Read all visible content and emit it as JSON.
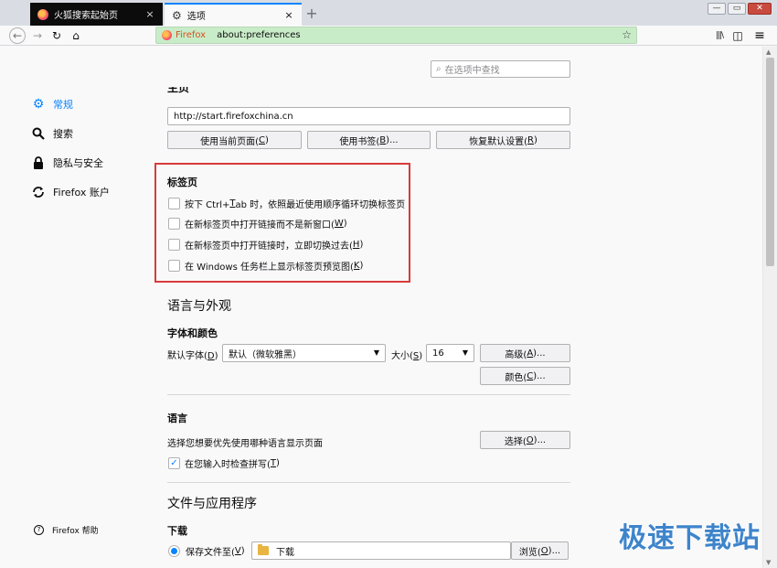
{
  "tabs": [
    {
      "title": "火狐搜索起始页",
      "close": "×"
    },
    {
      "title": "选项",
      "close": "×"
    }
  ],
  "newtab": "+",
  "window_controls": {
    "minimize": "—",
    "maximize": "▭",
    "close": "✕"
  },
  "navbar": {
    "back": "←",
    "forward": "→",
    "reload": "↻",
    "home": "⌂",
    "identity": "Firefox",
    "url": "about:preferences",
    "star": "☆",
    "library": "|||\\",
    "sidebar": "◫",
    "menu": "≡"
  },
  "search": {
    "placeholder": "在选项中查找",
    "icon": "⌕"
  },
  "sidebar": {
    "items": [
      {
        "label": "常规",
        "icon": "gear-icon",
        "selected": true
      },
      {
        "label": "搜索",
        "icon": "search-icon"
      },
      {
        "label": "隐私与安全",
        "icon": "lock-icon"
      },
      {
        "label": "Firefox 账户",
        "icon": "sync-icon"
      }
    ],
    "help": "Firefox 帮助"
  },
  "homepage": {
    "heading": "主页",
    "url": "http://start.firefoxchina.cn",
    "btn_current": "使用当前页面(",
    "btn_current_key": "C",
    "btn_bookmark": "使用书签(",
    "btn_bookmark_key": "B",
    "btn_bookmark_tail": ")...",
    "btn_restore": "恢复默认设置(",
    "btn_restore_key": "R"
  },
  "tabs_section": {
    "heading": "标签页",
    "options": [
      {
        "pre": "按下 Ctrl+",
        "key": "T",
        "post": "ab 时，依照最近使用顺序循环切换标签页",
        "checked": false
      },
      {
        "pre": "在新标签页中打开链接而不是新窗口(",
        "key": "W",
        "post": ")",
        "checked": false
      },
      {
        "pre": "在新标签页中打开链接时，立即切换过去(",
        "key": "H",
        "post": ")",
        "checked": false
      },
      {
        "pre": "在 Windows 任务栏上显示标签页预览图(",
        "key": "K",
        "post": ")",
        "checked": false
      }
    ]
  },
  "appearance": {
    "heading": "语言与外观",
    "fonts_heading": "字体和颜色",
    "default_font_label": "默认字体(",
    "default_font_key": "D",
    "default_font_value": "默认（微软雅黑）",
    "size_label": "大小(",
    "size_key": "S",
    "size_value": "16",
    "advanced_btn": "高级(",
    "advanced_key": "A",
    "colors_btn": "颜色(",
    "colors_key": "C",
    "btn_tail": ")..."
  },
  "language": {
    "heading": "语言",
    "description": "选择您想要优先使用哪种语言显示页面",
    "choose_btn": "选择(",
    "choose_key": "O",
    "spellcheck_pre": "在您输入时检查拼写(",
    "spellcheck_key": "T",
    "spellcheck_checked": true
  },
  "files": {
    "heading": "文件与应用程序",
    "downloads_heading": "下载",
    "save_to_pre": "保存文件至(",
    "save_to_key": "V",
    "folder_name": "下载",
    "browse_btn": "浏览(",
    "browse_key": "O"
  },
  "watermark": "极速下载站",
  "colors": {
    "accent": "#0a84ff",
    "highlight": "#d83b3b",
    "urlbar": "#c9ecc8"
  }
}
